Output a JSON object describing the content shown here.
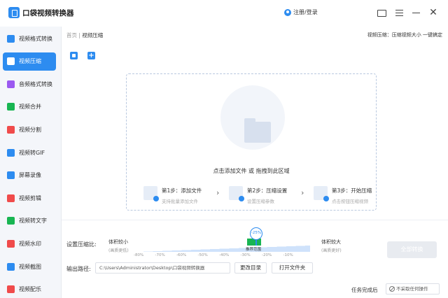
{
  "app": {
    "title": "口袋视频转换器",
    "login": "注册/登录"
  },
  "sidebar": {
    "items": [
      {
        "label": "视频格式转换",
        "color": "#2d8cf0"
      },
      {
        "label": "视频压缩",
        "color": "#ffffff"
      },
      {
        "label": "音频格式转换",
        "color": "#9b59f0"
      },
      {
        "label": "视频合并",
        "color": "#18b552"
      },
      {
        "label": "视频分割",
        "color": "#f04b4b"
      },
      {
        "label": "视频转GIF",
        "color": "#2d8cf0"
      },
      {
        "label": "屏幕录像",
        "color": "#2d8cf0"
      },
      {
        "label": "视频剪辑",
        "color": "#f04b4b"
      },
      {
        "label": "视频转文字",
        "color": "#18b552"
      },
      {
        "label": "视频水印",
        "color": "#f04b4b"
      },
      {
        "label": "视频截图",
        "color": "#2d8cf0"
      },
      {
        "label": "视频配乐",
        "color": "#f04b4b"
      }
    ],
    "active_index": 1
  },
  "breadcrumb": {
    "home": "首页",
    "sep": " | ",
    "current": "视频压缩"
  },
  "hint": "视频压缩：压缩视频大小 一键搞定",
  "dropzone": {
    "text": "点击添加文件 或 拖拽到此区域",
    "steps": [
      {
        "title": "第1步：添加文件",
        "sub": "支持批量添加文件"
      },
      {
        "title": "第2步：压缩设置",
        "sub": "设置压缩参数"
      },
      {
        "title": "第3步：开始压缩",
        "sub": "点击按钮压缩视频"
      }
    ]
  },
  "compression": {
    "label": "设置压缩比:",
    "left_title": "体积较小",
    "left_sub": "(画质更低)",
    "right_title": "体积较大",
    "right_sub": "(画质更好)",
    "value": "-25%",
    "recommend": "推荐范围",
    "ticks": [
      "-80%",
      "-70%",
      "-60%",
      "-50%",
      "-40%",
      "-30%",
      "-20%",
      "-10%"
    ]
  },
  "output": {
    "label": "输出路径:",
    "path": "C:\\Users\\Administrator\\Desktop\\口袋视频转换器",
    "change_btn": "更改目录",
    "open_btn": "打开文件夹"
  },
  "convert_btn": "全部转换",
  "footer": {
    "label": "任务完成后",
    "select": "不采取任何操作"
  }
}
